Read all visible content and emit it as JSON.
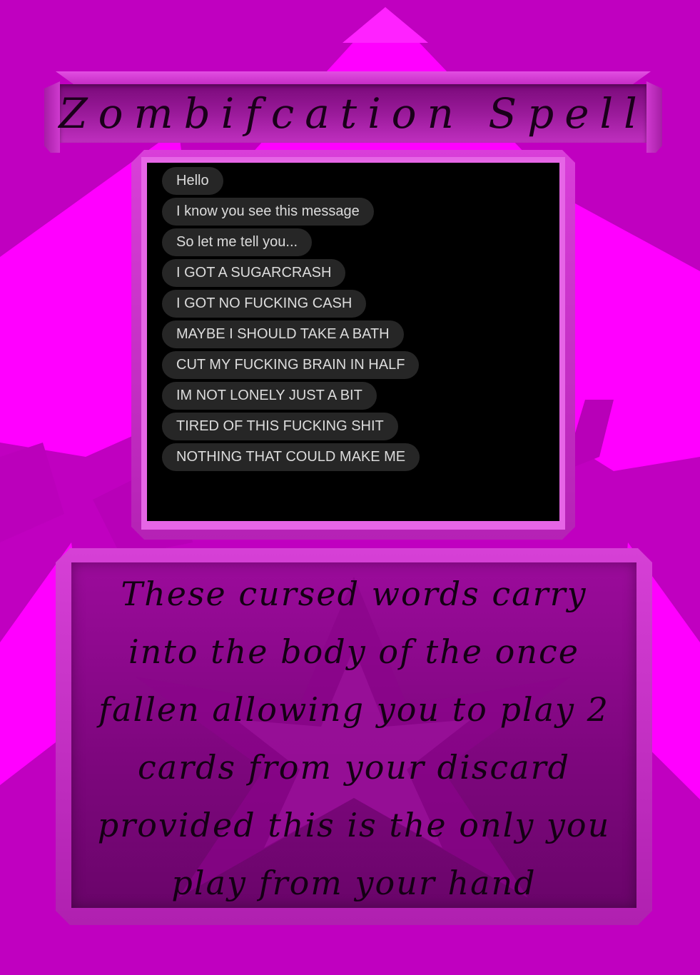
{
  "card": {
    "title": "Zombifcation Spell",
    "messages": [
      "Hello",
      "I know you see this message",
      "So let me tell you...",
      "I GOT A SUGARCRASH",
      "I GOT NO FUCKING CASH",
      "MAYBE I SHOULD TAKE A BATH",
      "CUT MY FUCKING BRAIN IN HALF",
      "IM NOT LONELY JUST A BIT",
      "TIRED OF THIS FUCKING SHIT",
      "NOTHING THAT COULD MAKE ME"
    ],
    "description": "These cursed words carry into the body of the once fallen allowing you to play 2 cards from your discard provided this is the only you play from your hand"
  },
  "colors": {
    "background": "#c000c0",
    "accent_light": "#ff00ff",
    "frame": "#d040d0",
    "chat_background": "#000000",
    "bubble": "#262626",
    "bubble_text": "#dcdcdc"
  }
}
